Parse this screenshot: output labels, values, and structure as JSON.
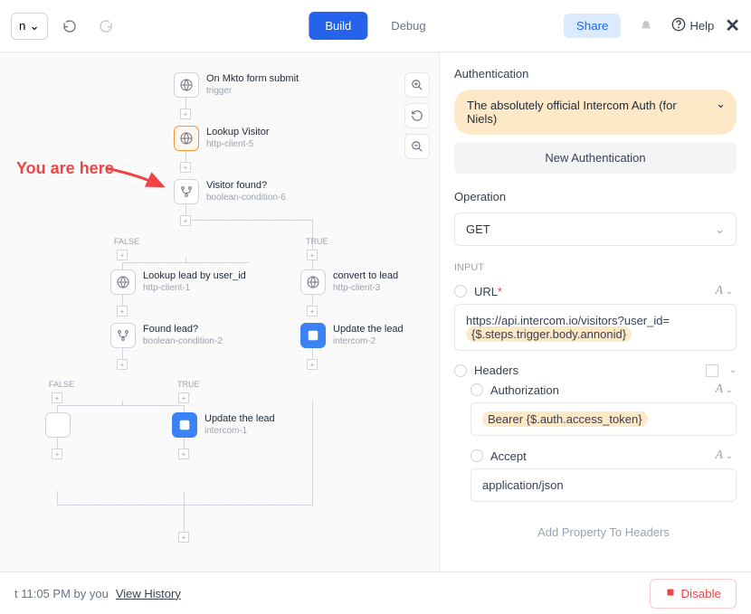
{
  "topbar": {
    "dropdown_suffix": "n",
    "build_label": "Build",
    "debug_label": "Debug",
    "share_label": "Share",
    "help_label": "Help"
  },
  "annotation": "You are here",
  "canvas": {
    "nodes": {
      "trigger": {
        "title": "On Mkto form submit",
        "sub": "trigger"
      },
      "lookup_visitor": {
        "title": "Lookup Visitor",
        "sub": "http-client-5"
      },
      "visitor_found": {
        "title": "Visitor found?",
        "sub": "boolean-condition-6"
      },
      "lookup_lead": {
        "title": "Lookup lead by user_id",
        "sub": "http-client-1"
      },
      "convert_lead": {
        "title": "convert to lead",
        "sub": "http-client-3"
      },
      "found_lead": {
        "title": "Found lead?",
        "sub": "boolean-condition-2"
      },
      "update_lead_1": {
        "title": "Update the lead",
        "sub": "intercom-2"
      },
      "update_lead_2": {
        "title": "Update the lead",
        "sub": "intercom-1"
      }
    },
    "labels": {
      "false": "FALSE",
      "true": "TRUE"
    }
  },
  "panel": {
    "auth_label": "Authentication",
    "auth_value": "The absolutely official Intercom Auth (for Niels)",
    "new_auth_label": "New Authentication",
    "operation_label": "Operation",
    "operation_value": "GET",
    "input_label": "INPUT",
    "url_label": "URL",
    "url_value_prefix": "https://api.intercom.io/visitors?user_id=",
    "url_token": "{$.steps.trigger.body.annonid}",
    "headers_label": "Headers",
    "auth_header_label": "Authorization",
    "auth_header_value": "Bearer {$.auth.access_token}",
    "accept_label": "Accept",
    "accept_value": "application/json",
    "add_prop_label": "Add Property To Headers"
  },
  "footer": {
    "time_text": "t 11:05 PM by you",
    "view_history": "View History",
    "disable_label": "Disable"
  }
}
